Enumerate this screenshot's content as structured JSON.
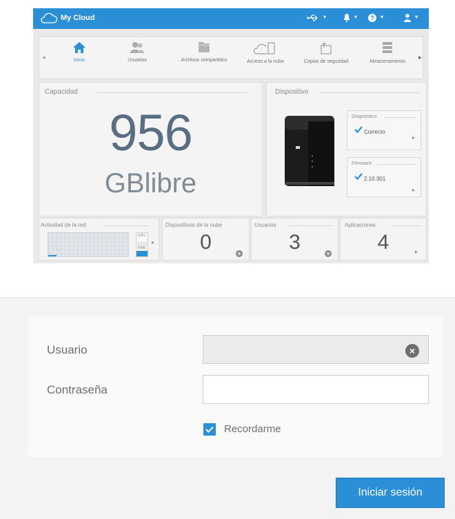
{
  "app": {
    "name": "My Cloud"
  },
  "nav": {
    "items": [
      {
        "label": "Inicio",
        "icon": "home-icon",
        "active": true
      },
      {
        "label": "Usuarios",
        "icon": "users-icon"
      },
      {
        "label": "Archivos compartidos",
        "icon": "folder-icon"
      },
      {
        "label": "Acceso a la nube",
        "icon": "cloud-device-icon"
      },
      {
        "label": "Copias de seguridad",
        "icon": "backup-icon"
      },
      {
        "label": "Almacenamiento",
        "icon": "storage-icon"
      }
    ]
  },
  "capacity": {
    "title": "Capacidad",
    "value": "956",
    "unit": "GBlibre"
  },
  "device": {
    "title": "Dispositivo",
    "diagnostics": {
      "title": "Diagnóstico",
      "value": "Correcto"
    },
    "firmware": {
      "title": "Firmware",
      "value": "2.10.301"
    }
  },
  "network": {
    "title": "Actividad de la red",
    "cpu_label": "CPU",
    "ram_label": "RAM"
  },
  "cloud_devices": {
    "title": "Dispositivos de la nube",
    "value": "0"
  },
  "users": {
    "title": "Usuarios",
    "value": "3"
  },
  "apps": {
    "title": "Aplicaciones",
    "value": "4"
  },
  "login": {
    "username_label": "Usuario",
    "password_label": "Contraseña",
    "remember_label": "Recordarme",
    "remember_checked": true,
    "submit_label": "Iniciar sesión"
  },
  "colors": {
    "accent": "#2b8fd8",
    "capacity_text": "#596e80"
  }
}
